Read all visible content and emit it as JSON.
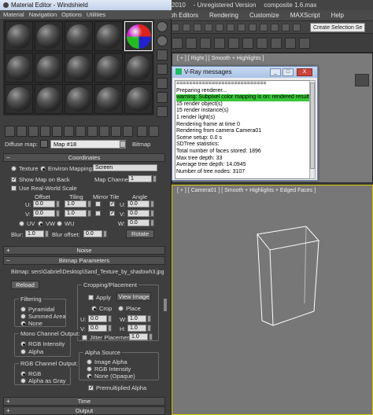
{
  "max": {
    "title_parts": [
      "2010",
      "- Unregistered Version",
      "composite 1.6.max"
    ],
    "menu": [
      "ph Editors",
      "Rendering",
      "Customize",
      "MAXScript",
      "Help"
    ],
    "selection_set": "Create Selection Se"
  },
  "viewports": {
    "right_label": "[ + ] [ Right ] [ Smooth + Highlights ]",
    "camera_label": "[ + ] [ Camera01 ] [ Smooth + Highlights + Edged Faces ]"
  },
  "vray": {
    "title": "V-Ray messages",
    "controls": [
      "_",
      "□",
      "X"
    ],
    "log": [
      "============================",
      "Preparing renderer...",
      "warning: Subpixel color mapping is on: rendered result may h",
      "15 render object(s)",
      "15 render instance(s)",
      "1 render light(s)",
      "Rendering frame at time 0",
      "Rendering from camera Camera01",
      "Scene setup: 0.0 s",
      "SDTree statistics:",
      "Total number of faces stored: 1896",
      "Max tree depth: 33",
      "Average tree depth: 14.0945",
      "Number of tree nodes: 3107"
    ]
  },
  "mated": {
    "title": "Material Editor - Windshield",
    "menu": [
      "Material",
      "Navigation",
      "Options",
      "Utilities"
    ],
    "diffuse_label": "Diffuse map:",
    "map_name": "Map #18",
    "map_type": "Bitmap",
    "coordinates": {
      "head": "Coordinates",
      "texture": "Texture",
      "environ": "Environ",
      "mapping_label": "Mapping:",
      "mapping_value": "Screen",
      "show_map": "Show Map on Back",
      "map_channel_label": "Map Channel:",
      "map_channel": "1",
      "real_world": "Use Real-World Scale",
      "col_offset": "Offset",
      "col_tiling": "Tiling",
      "col_mirror": "Mirror Tile",
      "col_angle": "Angle",
      "u_label": "U:",
      "v_label": "V:",
      "w_label": "W:",
      "u_offset": "0.0",
      "v_offset": "0.0",
      "u_tiling": "1.0",
      "v_tiling": "1.0",
      "u_angle": "0.0",
      "v_angle": "0.0",
      "w_angle": "0.0",
      "uv": "UV",
      "vw": "VW",
      "wu": "WU",
      "blur_label": "Blur:",
      "blur": "1.0",
      "blur_offset_label": "Blur offset:",
      "blur_offset": "0.0",
      "rotate": "Rotate"
    },
    "noise_head": "Noise",
    "bitmap": {
      "head": "Bitmap Parameters",
      "path": "Bitmap: sers\\Gabriel\\Desktop\\Sand_Texture_by_shadowh3.jpg",
      "reload": "Reload",
      "cropping": "Cropping/Placement",
      "apply": "Apply",
      "view_image": "View Image",
      "crop": "Crop",
      "place": "Place",
      "u_label": "U:",
      "v_label": "V:",
      "w_label": "W:",
      "h_label": "H:",
      "u": "0.0",
      "v": "0.0",
      "w": "1.0",
      "h": "1.0",
      "jitter_label": "Jitter Placement:",
      "jitter": "1.0",
      "filtering": "Filtering",
      "pyramidal": "Pyramidal",
      "summed": "Summed Area",
      "none": "None",
      "mono": "Mono Channel Output:",
      "rgb_intensity": "RGB Intensity",
      "alpha": "Alpha",
      "rgb_channel": "RGB Channel Output:",
      "rgb": "RGB",
      "alpha_gray": "Alpha as Gray",
      "alpha_source": "Alpha Source",
      "image_alpha": "Image Alpha",
      "as_rgb": "RGB Intensity",
      "none_opaque": "None (Opaque)",
      "premultiplied": "Premultiplied Alpha"
    },
    "time_head": "Time",
    "output_head": "Output"
  }
}
